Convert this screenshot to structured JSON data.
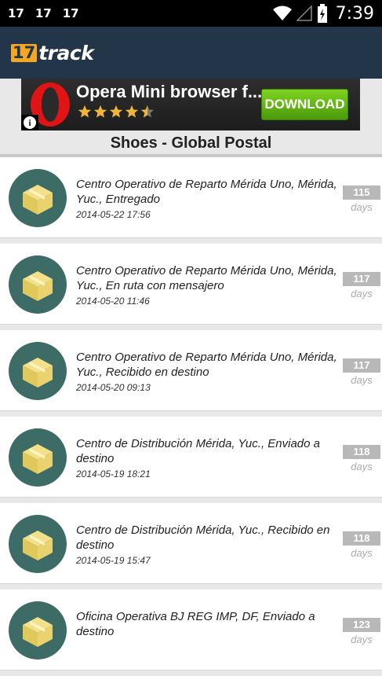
{
  "status_bar": {
    "notifications": [
      "17",
      "17",
      "17"
    ],
    "time": "7:39"
  },
  "app": {
    "logo_number": "17",
    "logo_word": "track"
  },
  "ad": {
    "title": "Opera Mini browser f...",
    "rating": 4.5,
    "download_label": "DOWNLOAD",
    "info_label": "i"
  },
  "package": {
    "title": "Shoes - Global Postal"
  },
  "events": [
    {
      "location": "Centro Operativo de Reparto Mérida Uno, Mérida, Yuc., Entregado",
      "datetime": "2014-05-22 17:56",
      "days": "115",
      "days_label": "days"
    },
    {
      "location": "Centro Operativo de Reparto Mérida Uno, Mérida, Yuc., En ruta con mensajero",
      "datetime": "2014-05-20 11:46",
      "days": "117",
      "days_label": "days"
    },
    {
      "location": "Centro Operativo de Reparto Mérida Uno, Mérida, Yuc., Recibido en destino",
      "datetime": "2014-05-20 09:13",
      "days": "117",
      "days_label": "days"
    },
    {
      "location": "Centro de Distribución Mérida, Yuc., Enviado a destino",
      "datetime": "2014-05-19 18:21",
      "days": "118",
      "days_label": "days"
    },
    {
      "location": "Centro de Distribución Mérida, Yuc., Recibido en destino",
      "datetime": "2014-05-19 15:47",
      "days": "118",
      "days_label": "days"
    },
    {
      "location": "Oficina Operativa BJ REG IMP, DF, Enviado a destino",
      "datetime": "",
      "days": "123",
      "days_label": "days"
    }
  ],
  "colors": {
    "app_bar": "#233548",
    "icon_circle": "#3d6b66",
    "box": "#e8d36a",
    "accent": "#f5a623"
  }
}
